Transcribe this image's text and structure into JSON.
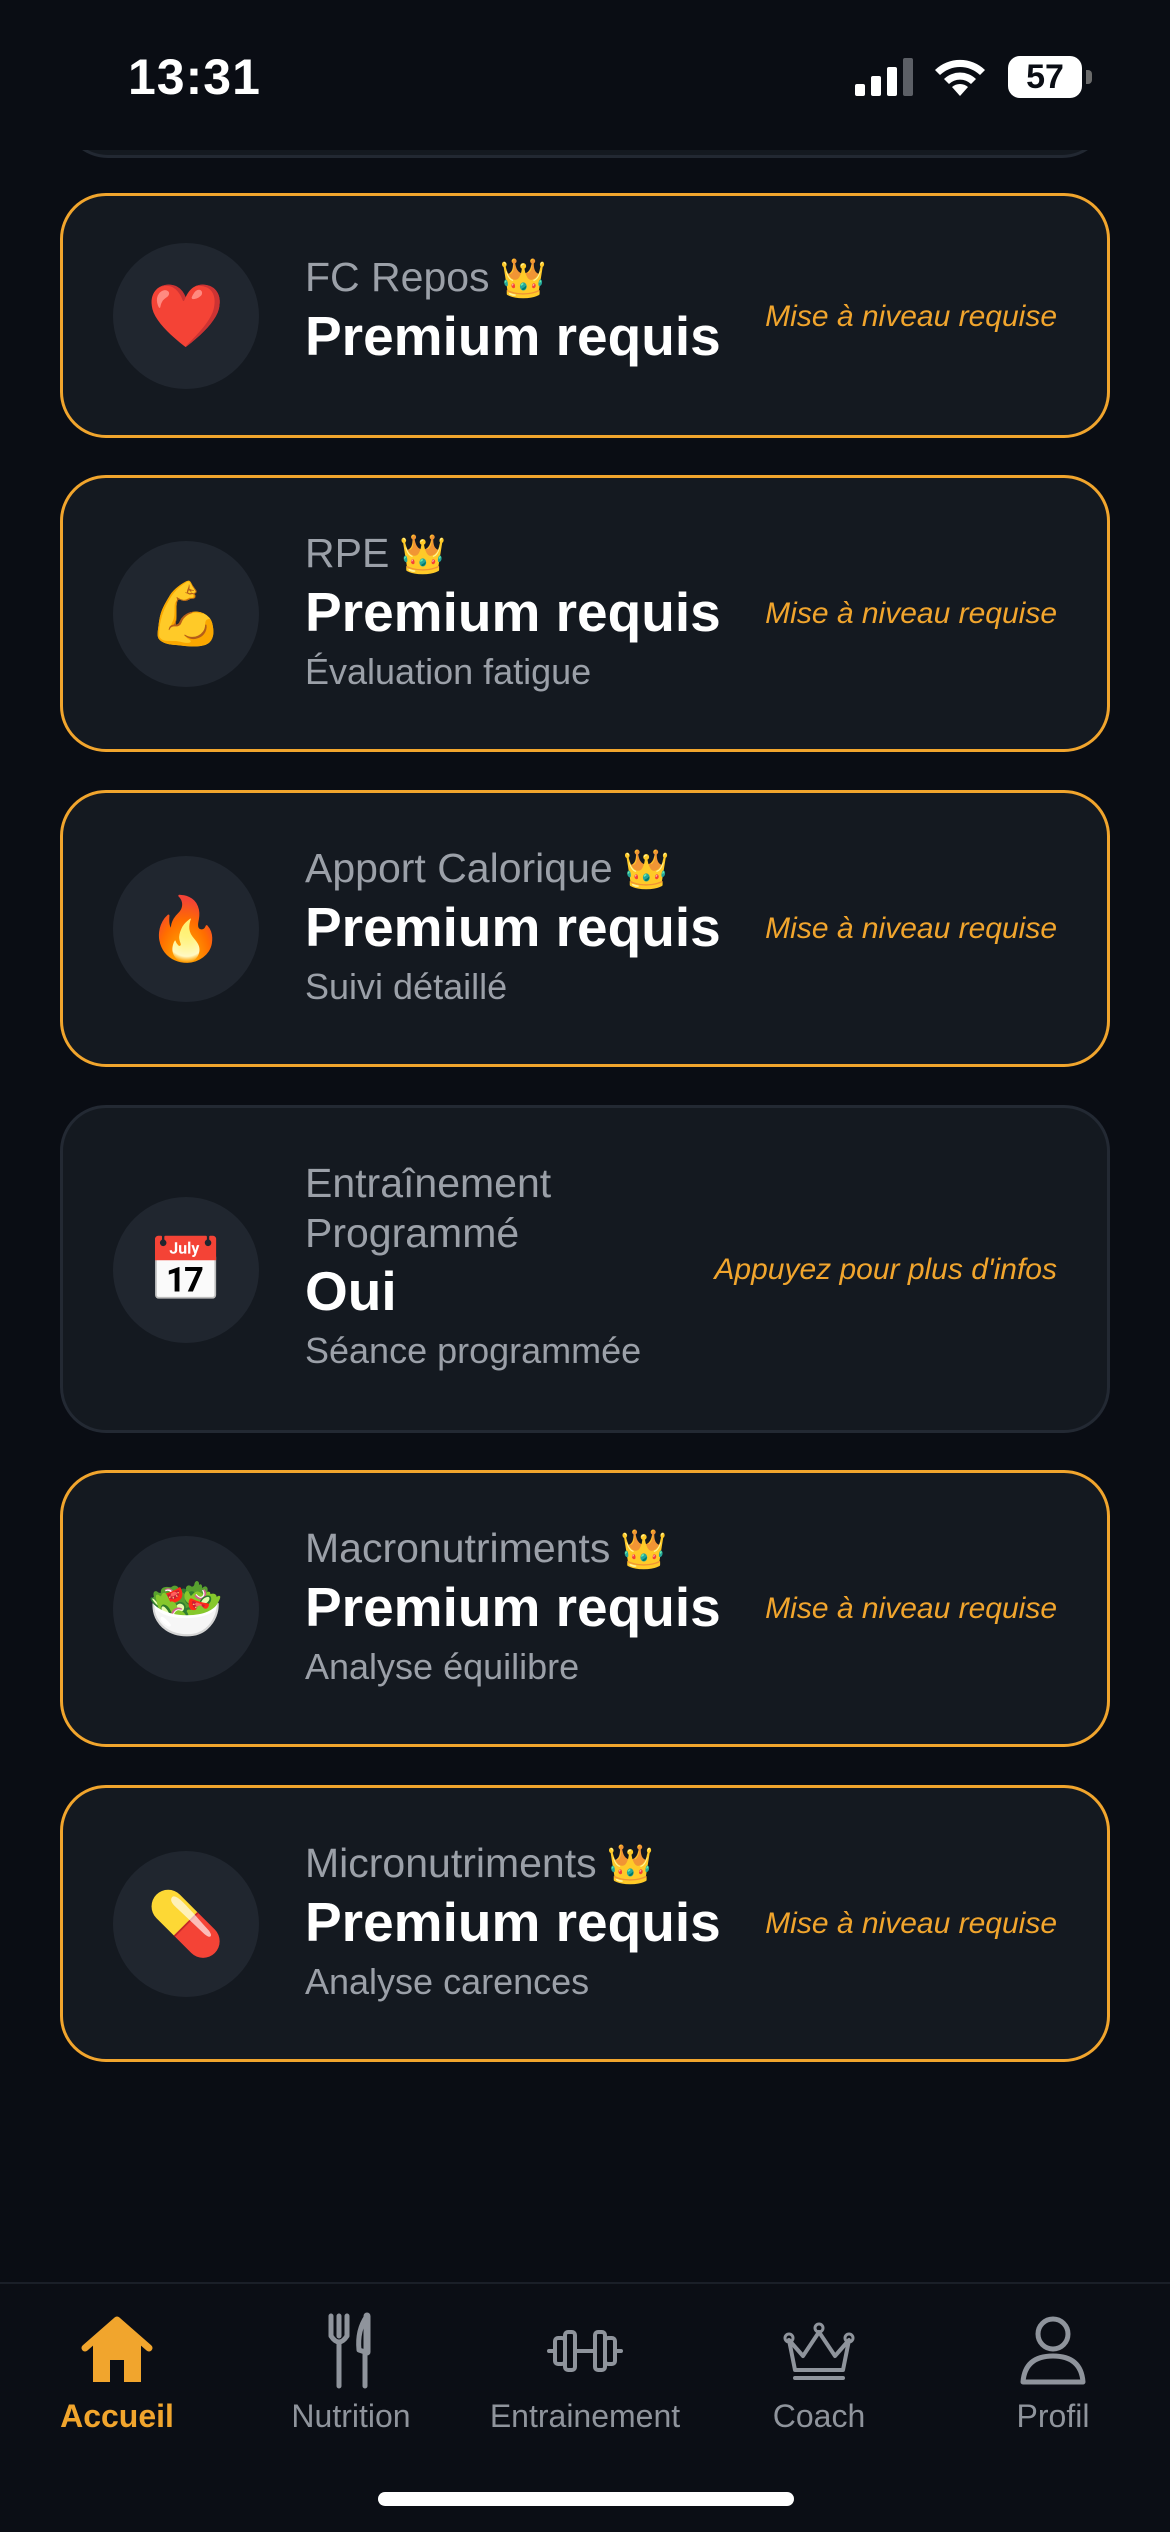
{
  "status_bar": {
    "time": "13:31",
    "battery": "57"
  },
  "colors": {
    "accent": "#f1a52d",
    "background": "#0a0d14",
    "card": "#141920"
  },
  "cards": [
    {
      "icon": "❤️",
      "icon_name": "heart-icon",
      "label": "FC Repos",
      "premium": true,
      "value": "Premium requis",
      "sub": "",
      "action": "Mise à niveau requise"
    },
    {
      "icon": "💪",
      "icon_name": "flexed-biceps-icon",
      "label": "RPE",
      "premium": true,
      "value": "Premium requis",
      "sub": "Évaluation fatigue",
      "action": "Mise à niveau requise"
    },
    {
      "icon": "🔥",
      "icon_name": "fire-icon",
      "label": "Apport Calorique",
      "premium": true,
      "value": "Premium requis",
      "sub": "Suivi détaillé",
      "action": "Mise à niveau requise"
    },
    {
      "icon": "📅",
      "icon_name": "calendar-icon",
      "label": "Entraînement Programmé",
      "premium": false,
      "value": "Oui",
      "sub": "Séance programmée",
      "action": "Appuyez pour plus d'infos"
    },
    {
      "icon": "🥗",
      "icon_name": "salad-icon",
      "label": "Macronutriments",
      "premium": true,
      "value": "Premium requis",
      "sub": "Analyse équilibre",
      "action": "Mise à niveau requise"
    },
    {
      "icon": "💊",
      "icon_name": "pill-icon",
      "label": "Micronutriments",
      "premium": true,
      "value": "Premium requis",
      "sub": "Analyse carences",
      "action": "Mise à niveau requise"
    }
  ],
  "tab_bar": {
    "tabs": [
      {
        "label": "Accueil",
        "icon": "home-icon",
        "active": true
      },
      {
        "label": "Nutrition",
        "icon": "fork-knife-icon",
        "active": false
      },
      {
        "label": "Entrainement",
        "icon": "dumbbell-icon",
        "active": false
      },
      {
        "label": "Coach",
        "icon": "crown-icon",
        "active": false
      },
      {
        "label": "Profil",
        "icon": "person-icon",
        "active": false
      }
    ]
  }
}
